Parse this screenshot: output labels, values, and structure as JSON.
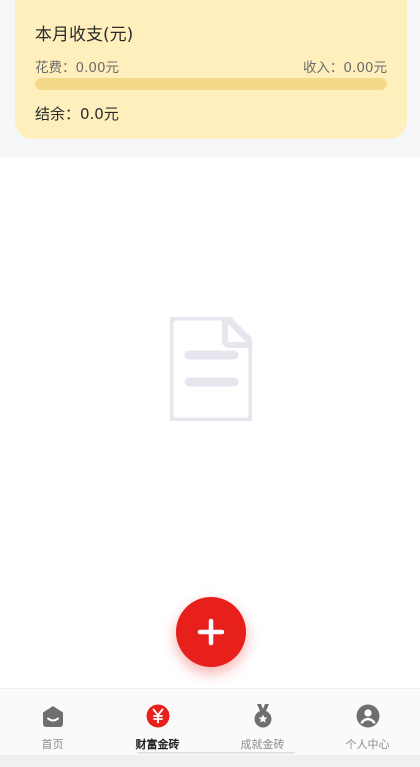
{
  "summary": {
    "title": "本月收支(元)",
    "spend": "花费：0.00元",
    "income": "收入：0.00元",
    "balance": "结余：0.0元",
    "spend_ratio": 0
  },
  "empty_state": {
    "icon": "document-icon"
  },
  "fab": {
    "icon": "plus-icon",
    "symbol": "+"
  },
  "tabbar": {
    "tabs": [
      {
        "label": "首页",
        "icon": "home-icon",
        "active": false
      },
      {
        "label": "财富金砖",
        "icon": "yen-icon",
        "active": true
      },
      {
        "label": "成就金砖",
        "icon": "medal-icon",
        "active": false
      },
      {
        "label": "个人中心",
        "icon": "user-icon",
        "active": false
      }
    ]
  },
  "colors": {
    "accent": "#e8201b",
    "card_bg": "#ffefbd",
    "progress_track": "#f4d986",
    "icon_gray": "#6f6f6f",
    "empty_icon": "#e6e7ee"
  }
}
